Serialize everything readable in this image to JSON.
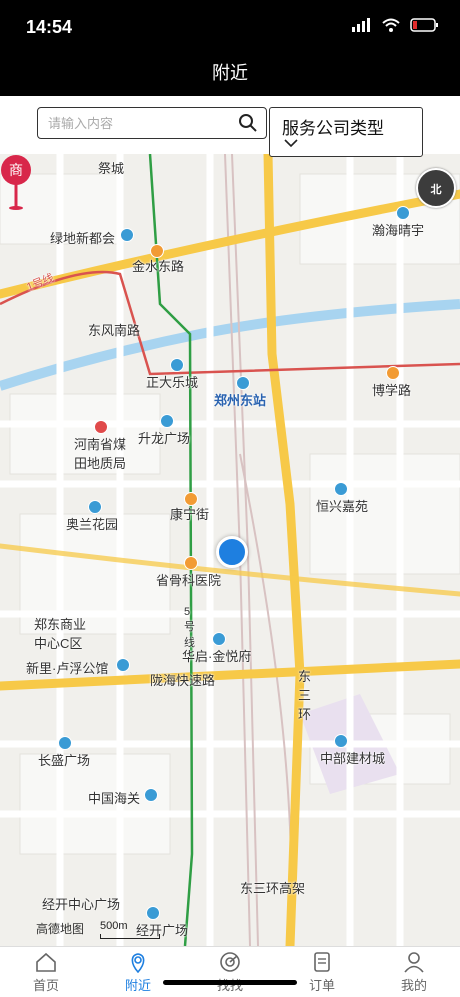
{
  "status": {
    "time": "14:54"
  },
  "nav": {
    "title": "附近"
  },
  "search": {
    "placeholder": "请输入内容",
    "type_label": "服务公司类型"
  },
  "map": {
    "labels": [
      {
        "text": "祭城"
      },
      {
        "text": "瀚海晴宇"
      },
      {
        "text": "绿地新都会"
      },
      {
        "text": "金水东路"
      },
      {
        "text": "东风南路"
      },
      {
        "text": "正大乐城"
      },
      {
        "text": "郑州东站"
      },
      {
        "text": "博学路"
      },
      {
        "text": "河南省煤田地质局"
      },
      {
        "text": "升龙广场"
      },
      {
        "text": "恒兴嘉苑"
      },
      {
        "text": "奥兰花园"
      },
      {
        "text": "康宁街"
      },
      {
        "text": "省骨科医院"
      },
      {
        "text": "郑东商业中心C区"
      },
      {
        "text": "5号线"
      },
      {
        "text": "华启·金悦府"
      },
      {
        "text": "新里·卢浮公馆"
      },
      {
        "text": "陇海快速路"
      },
      {
        "text": "东三环"
      },
      {
        "text": "长盛广场"
      },
      {
        "text": "中部建材城"
      },
      {
        "text": "中国海关"
      },
      {
        "text": "东三环高架"
      },
      {
        "text": "经开中心广场"
      },
      {
        "text": "经开广场"
      },
      {
        "text": "1号线"
      },
      {
        "text": "商"
      }
    ],
    "compass": "北",
    "scale": "500m",
    "logo": "高德地图"
  },
  "tabs": [
    {
      "label": "首页",
      "icon": "home-icon"
    },
    {
      "label": "附近",
      "icon": "location-icon",
      "active": true
    },
    {
      "label": "找找",
      "icon": "radar-icon"
    },
    {
      "label": "订单",
      "icon": "order-icon"
    },
    {
      "label": "我的",
      "icon": "user-icon"
    }
  ],
  "colors": {
    "accent": "#1e7fe0",
    "road": "#f7c948",
    "metro_red": "#d9534f",
    "metro_green": "#2f9e44",
    "water": "#a8d4f0"
  }
}
